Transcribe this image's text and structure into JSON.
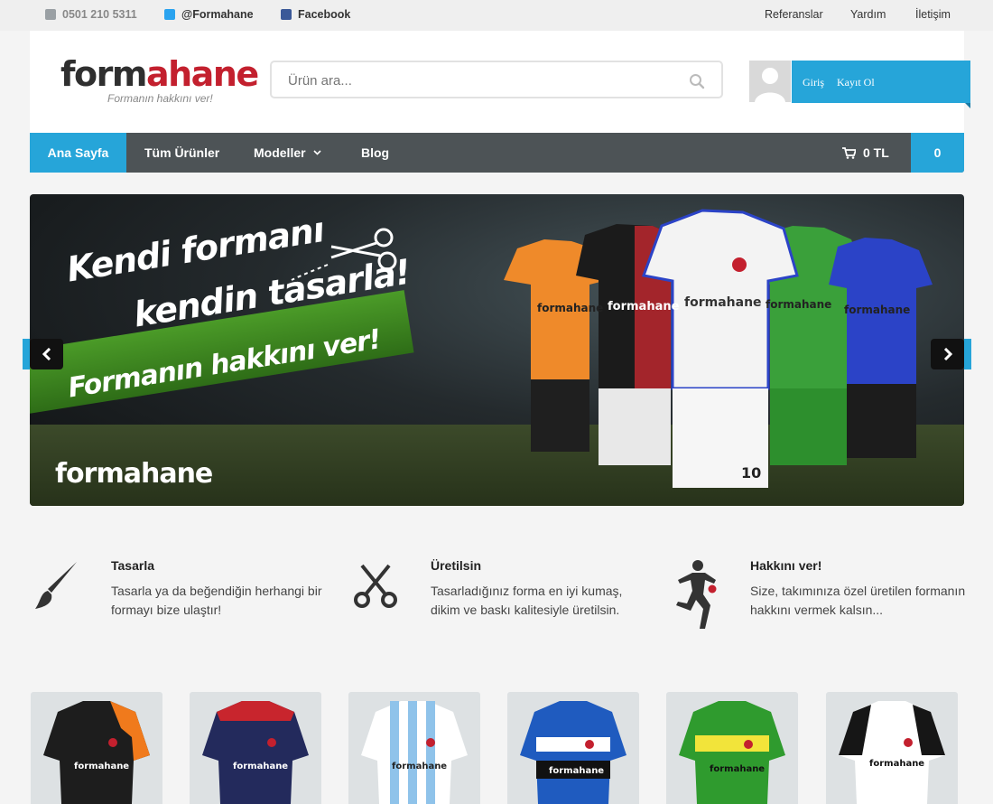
{
  "topbar": {
    "phone": "0501 210 5311",
    "twitter": "@Formahane",
    "facebook": "Facebook",
    "links": [
      "Referanslar",
      "Yardım",
      "İletişim"
    ]
  },
  "header": {
    "logo_dark": "form",
    "logo_red": "ahane",
    "logo_tagline": "Formanın hakkını ver!",
    "search_placeholder": "Ürün ara...",
    "login": "Giriş",
    "register": "Kayıt Ol"
  },
  "nav": {
    "items": [
      "Ana Sayfa",
      "Tüm Ürünler",
      "Modeller",
      "Blog"
    ],
    "cart_total": "0 TL",
    "cart_count": "0"
  },
  "slider": {
    "headline_1": "Kendi formanı",
    "headline_2": "kendin tasarla!",
    "band_text": "Formanın hakkını ver!",
    "logo": "formahane",
    "jersey_brand": "formahane",
    "jersey_number": "10"
  },
  "features": [
    {
      "title": "Tasarla",
      "text": "Tasarla ya da beğendiğin herhangi bir formayı bize ulaştır!"
    },
    {
      "title": "Üretilsin",
      "text": "Tasarladığınız forma en iyi kumaş, dikim ve baskı kalitesiyle üretilsin."
    },
    {
      "title": "Hakkını ver!",
      "text": "Size, takımınıza özel üretilen formanın hakkını vermek kalsın..."
    }
  ],
  "products": [
    {
      "brand": "formahane",
      "colors": [
        "#1d1d1d",
        "#f07a1c"
      ]
    },
    {
      "brand": "formahane",
      "colors": [
        "#232a5c",
        "#c8252d"
      ]
    },
    {
      "brand": "formahane",
      "colors": [
        "#ffffff",
        "#8fc3ea"
      ]
    },
    {
      "brand": "formahane",
      "colors": [
        "#1f5bbf",
        "#111111"
      ]
    },
    {
      "brand": "formahane",
      "colors": [
        "#2f9b2e",
        "#f2e43a"
      ]
    },
    {
      "brand": "formahane",
      "colors": [
        "#ffffff",
        "#161616"
      ]
    }
  ],
  "icons": {
    "phone": "phone-icon",
    "twitter": "twitter-icon",
    "facebook": "facebook-icon",
    "search": "search-icon",
    "avatar": "user-avatar-icon",
    "cart": "cart-icon",
    "chevron": "chevron-down-icon",
    "prev": "arrow-left-icon",
    "next": "arrow-right-icon",
    "feature_1": "paintbrush-icon",
    "feature_2": "scissors-icon",
    "feature_3": "football-player-icon"
  },
  "colors": {
    "accent": "#26a5d9",
    "brand_red": "#c3202e",
    "nav_bg": "#4d5356"
  }
}
